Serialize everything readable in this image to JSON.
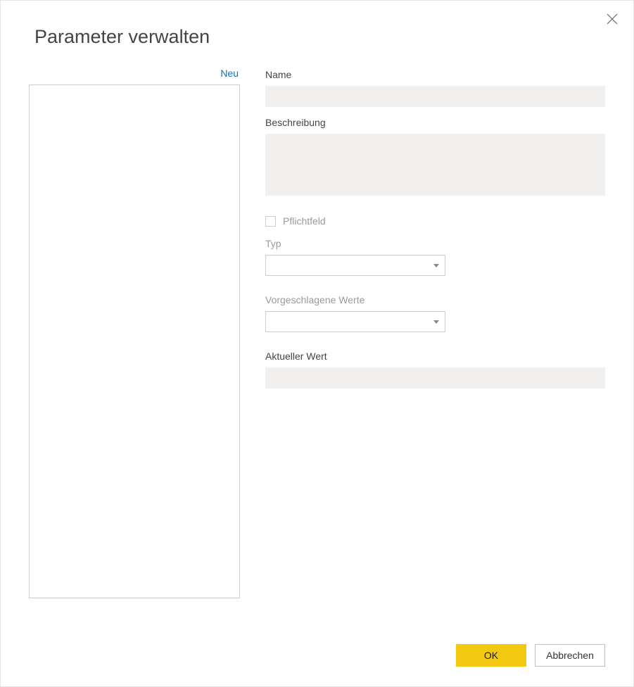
{
  "dialog": {
    "title": "Parameter verwalten"
  },
  "left": {
    "new_link": "Neu"
  },
  "fields": {
    "name_label": "Name",
    "name_value": "",
    "description_label": "Beschreibung",
    "description_value": "",
    "required_label": "Pflichtfeld",
    "required_checked": false,
    "type_label": "Typ",
    "type_value": "",
    "suggested_label": "Vorgeschlagene Werte",
    "suggested_value": "",
    "current_value_label": "Aktueller Wert",
    "current_value": ""
  },
  "footer": {
    "ok": "OK",
    "cancel": "Abbrechen"
  }
}
